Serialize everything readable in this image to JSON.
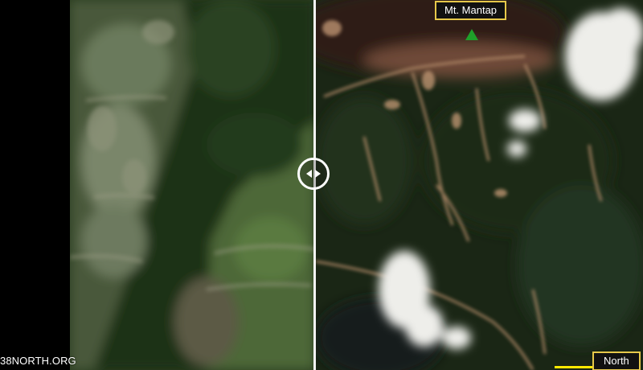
{
  "images": {
    "before": {
      "description_icon": "satellite-image-before"
    },
    "after": {
      "description_icon": "satellite-image-after"
    }
  },
  "slider": {
    "icon": "left-right-arrows-icon"
  },
  "annotations": {
    "peak_label": "Mt. Mantap",
    "peak_marker_color": "#1fa02a",
    "north_label": "North",
    "label_border_color": "#e6c84a"
  },
  "watermark": "38NORTH.ORG"
}
